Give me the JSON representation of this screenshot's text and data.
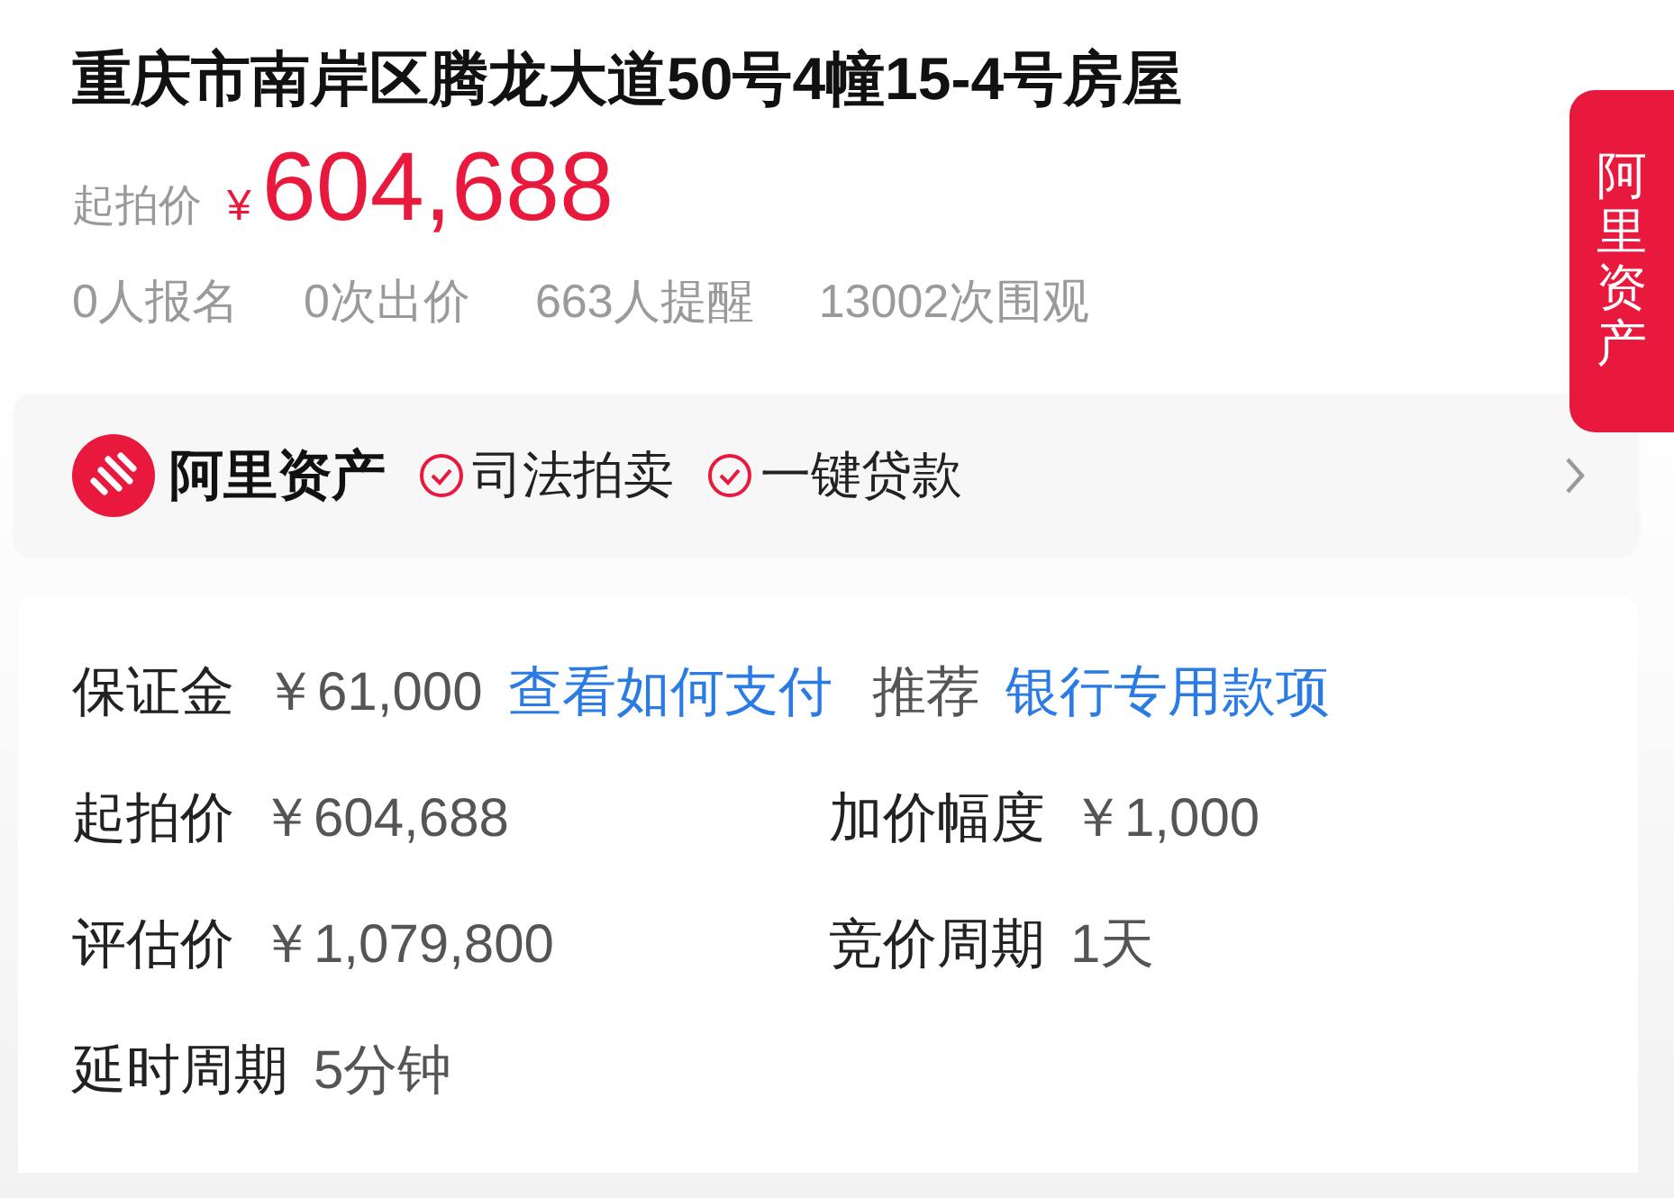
{
  "title": "重庆市南岸区腾龙大道50号4幢15-4号房屋",
  "price": {
    "label": "起拍价",
    "currency": "¥",
    "amount": "604,688"
  },
  "stats": [
    "0人报名",
    "0次出价",
    "663人提醒",
    "13002次围观"
  ],
  "side_tab": "阿里资产",
  "brand": {
    "name": "阿里资产",
    "badges": [
      "司法拍卖",
      "一键贷款"
    ]
  },
  "deposit": {
    "label": "保证金",
    "value": "￥61,000",
    "link": "查看如何支付",
    "recommend_label": "推荐",
    "recommend_link": "银行专用款项"
  },
  "details": [
    {
      "label": "起拍价",
      "value": "￥604,688"
    },
    {
      "label": "加价幅度",
      "value": "￥1,000"
    },
    {
      "label": "评估价",
      "value": "￥1,079,800"
    },
    {
      "label": "竞价周期",
      "value": "1天"
    },
    {
      "label": "延时周期",
      "value": "5分钟"
    }
  ]
}
